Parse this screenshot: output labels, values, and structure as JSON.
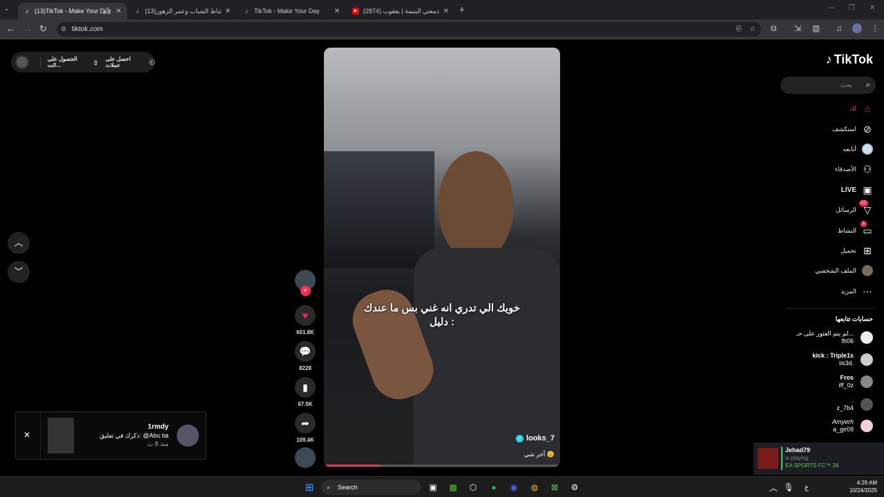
{
  "browser": {
    "tabs": [
      {
        "title": "(13)TikTok - Make Your Day",
        "icon": "tiktok-icon",
        "active": true,
        "audio": true
      },
      {
        "title": "(13)نشاط الشباب وعمر الزهور | ...",
        "icon": "tiktok-icon",
        "active": false
      },
      {
        "title": "TikTok - Make Your Day",
        "icon": "tiktok-icon",
        "active": false
      },
      {
        "title": "(2874) يا دمعتي اليتيمة | يعقوب ...",
        "icon": "youtube-icon",
        "active": false
      }
    ],
    "url": "tiktok.com"
  },
  "top_pill": {
    "get_coins": "احصل على عملات",
    "get_app": "الحصول على الت..."
  },
  "video": {
    "caption_line1": "خويك الي تدري انه غني بس ما عندك",
    "caption_line2": "دليل :",
    "author": "looks_7",
    "music": "آخر شي 😊",
    "progress": 0.24
  },
  "actions": {
    "likes": "601.8K",
    "comments": "8228",
    "saves": "67.5K",
    "shares": "109.4K"
  },
  "sidebar": {
    "logo": "TikTok",
    "search_placeholder": "بحث",
    "items": [
      {
        "label": "لك",
        "icon": "home-icon",
        "active": true
      },
      {
        "label": "استكشف",
        "icon": "compass-icon"
      },
      {
        "label": "أتابعه",
        "icon": "following-icon"
      },
      {
        "label": "الأصدقاء",
        "icon": "friends-icon"
      },
      {
        "label": "LIVE",
        "icon": "live-icon"
      },
      {
        "label": "الرسائل",
        "icon": "messages-icon",
        "badge": "12"
      },
      {
        "label": "النشاط",
        "icon": "activity-icon",
        "badge": "1"
      },
      {
        "label": "تحميل",
        "icon": "upload-icon"
      },
      {
        "label": "الملف الشخصي",
        "icon": "profile-avatar"
      },
      {
        "label": "المزيد",
        "icon": "more-icon"
      }
    ],
    "following_title": "حسابات تتابعها",
    "following": [
      {
        "name": "لم يتم العثور على حـ...",
        "handle": "fb06"
      },
      {
        "name": "kick : Triple1s",
        "handle": "iis3d."
      },
      {
        "name": "Fros",
        "handle": "iff_0z"
      },
      {
        "name": ".",
        "handle": "z_7b4"
      },
      {
        "name": "Amyerh",
        "handle": "a_gir09"
      }
    ]
  },
  "notification": {
    "user": "1rmdy",
    "text": "ذكرك في تعليق: @Abu tia",
    "time": "منذ 8 ث"
  },
  "toast": {
    "name": "Jehad79",
    "status": "is playing",
    "game": "EA SPORTS FC™ 26"
  },
  "taskbar": {
    "search": "Search",
    "time": "4:29 AM",
    "date": "10/24/2025",
    "lang": "ع"
  }
}
